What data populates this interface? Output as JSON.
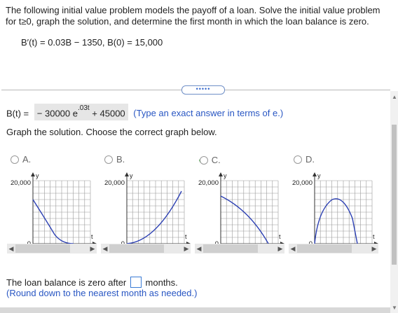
{
  "problem": {
    "text": "The following initial value problem models the payoff of a loan. Solve the initial value problem for t≥0, graph the solution, and determine the first month in which the loan balance is zero.",
    "ivp": "B′(t) = 0.03B − 1350, B(0) = 15,000"
  },
  "ellipsis": "•••••",
  "answer": {
    "lhs": "B(t) =",
    "part1": "− 30000 e",
    "exponent": ".03t",
    "part2": "+ 45000",
    "hint": "(Type an exact answer in terms of e.)"
  },
  "graph_question": "Graph the solution. Choose the correct graph below.",
  "options": [
    {
      "label": "A.",
      "selected": false
    },
    {
      "label": "B.",
      "selected": false
    },
    {
      "label": "C.",
      "selected": true
    },
    {
      "label": "D.",
      "selected": false
    }
  ],
  "graph_labels": {
    "y_axis": "y",
    "x_axis": "t",
    "y_tick": "20,000",
    "origin": "0"
  },
  "loan": {
    "before": "The loan balance is zero after",
    "after": "months.",
    "round_hint": "(Round down to the nearest month as needed.)"
  },
  "colors": {
    "accent": "#2856c3",
    "curve": "#2b3fb3",
    "check": "#2a9c2a"
  }
}
